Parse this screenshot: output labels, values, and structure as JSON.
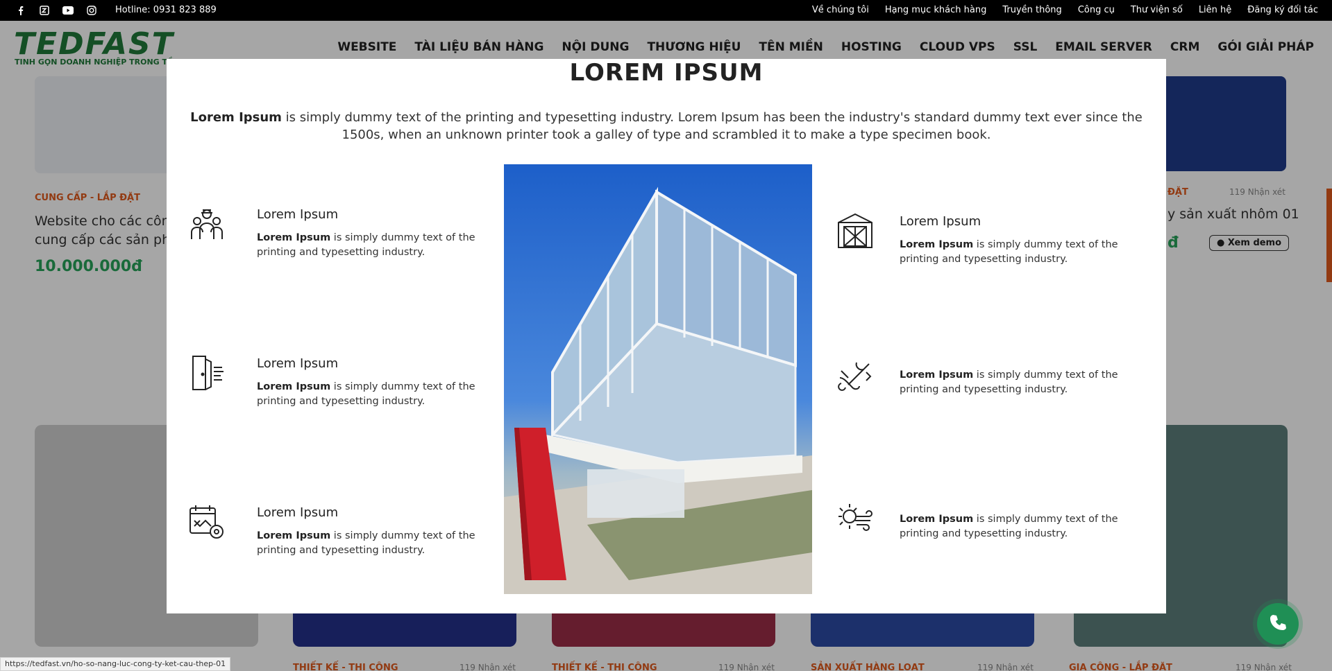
{
  "topbar": {
    "hotline": "Hotline: 0931 823 889",
    "social": [
      "facebook-icon",
      "zalo-icon",
      "youtube-icon",
      "instagram-icon"
    ],
    "links": [
      "Về chúng tôi",
      "Hạng mục khách hàng",
      "Truyền thông",
      "Công cụ",
      "Thư viện số",
      "Liên hệ",
      "Đăng ký đối tác"
    ]
  },
  "header": {
    "logo": "TEDFAST",
    "tagline": "TINH GỌN DOANH NGHIỆP TRONG TẦ",
    "nav": [
      "WEBSITE",
      "TÀI LIỆU BÁN HÀNG",
      "NỘI DUNG",
      "THƯƠNG HIỆU",
      "TÊN MIỀN",
      "HOSTING",
      "CLOUD VPS",
      "SSL",
      "EMAIL SERVER",
      "CRM",
      "GÓI GIẢI PHÁP"
    ]
  },
  "background": {
    "card1": {
      "category": "CUNG CẤP - LẮP ĐẶT",
      "desc_line1": "Website cho các công",
      "desc_line2": "cung cấp các sản phẩ",
      "price": "10.000.000đ"
    },
    "card5": {
      "category": "ĐẶT",
      "reviews": "119 Nhận xét",
      "desc": "y sản xuất nhôm 01",
      "price": "đ",
      "demo": "Xem demo"
    },
    "bottom_cards": [
      {
        "category": "",
        "reviews": ""
      },
      {
        "category": "THIẾT KẾ - THI CÔNG",
        "reviews": "119 Nhận xét"
      },
      {
        "category": "THIẾT KẾ - THI CÔNG",
        "reviews": "119 Nhận xét"
      },
      {
        "category": "SẢN XUẤT HÀNG LOẠT",
        "reviews": "119 Nhận xét"
      },
      {
        "category": "GIA CÔNG - LẮP ĐẶT",
        "reviews": "119 Nhận xét"
      }
    ]
  },
  "modal": {
    "title": "LOREM IPSUM",
    "intro_bold": "Lorem Ipsum",
    "intro_rest": " is simply dummy text of the printing and typesetting industry. Lorem Ipsum has been the industry's standard dummy text ever since the 1500s, when an unknown printer took a galley of type and scrambled it to make a type specimen book.",
    "features_left": [
      {
        "icon": "workers-icon",
        "title": "Lorem Ipsum",
        "bold": "Lorem Ipsum",
        "text": " is simply dummy text of the printing and typesetting industry."
      },
      {
        "icon": "door-wind-icon",
        "title": "Lorem Ipsum",
        "bold": "Lorem Ipsum",
        "text": " is simply dummy text of the printing and typesetting industry."
      },
      {
        "icon": "calendar-gear-icon",
        "title": "Lorem Ipsum",
        "bold": "Lorem Ipsum",
        "text": " is simply dummy text of the printing and typesetting industry."
      }
    ],
    "features_right": [
      {
        "icon": "warehouse-icon",
        "title": "Lorem Ipsum",
        "bold": "Lorem Ipsum",
        "text": " is simply dummy text of the printing and typesetting industry."
      },
      {
        "icon": "tools-hand-icon",
        "title": "",
        "bold": "Lorem Ipsum",
        "text": " is simply dummy text of the printing and typesetting industry."
      },
      {
        "icon": "sun-wind-icon",
        "title": "",
        "bold": "Lorem Ipsum",
        "text": " is simply dummy text of the printing and typesetting industry."
      }
    ]
  },
  "status_url": "https://tedfast.vn/ho-so-nang-luc-cong-ty-ket-cau-thep-01",
  "colors": {
    "brand_green": "#1f7a3a",
    "accent_orange": "#e05a1c",
    "price_green": "#27a35a"
  }
}
